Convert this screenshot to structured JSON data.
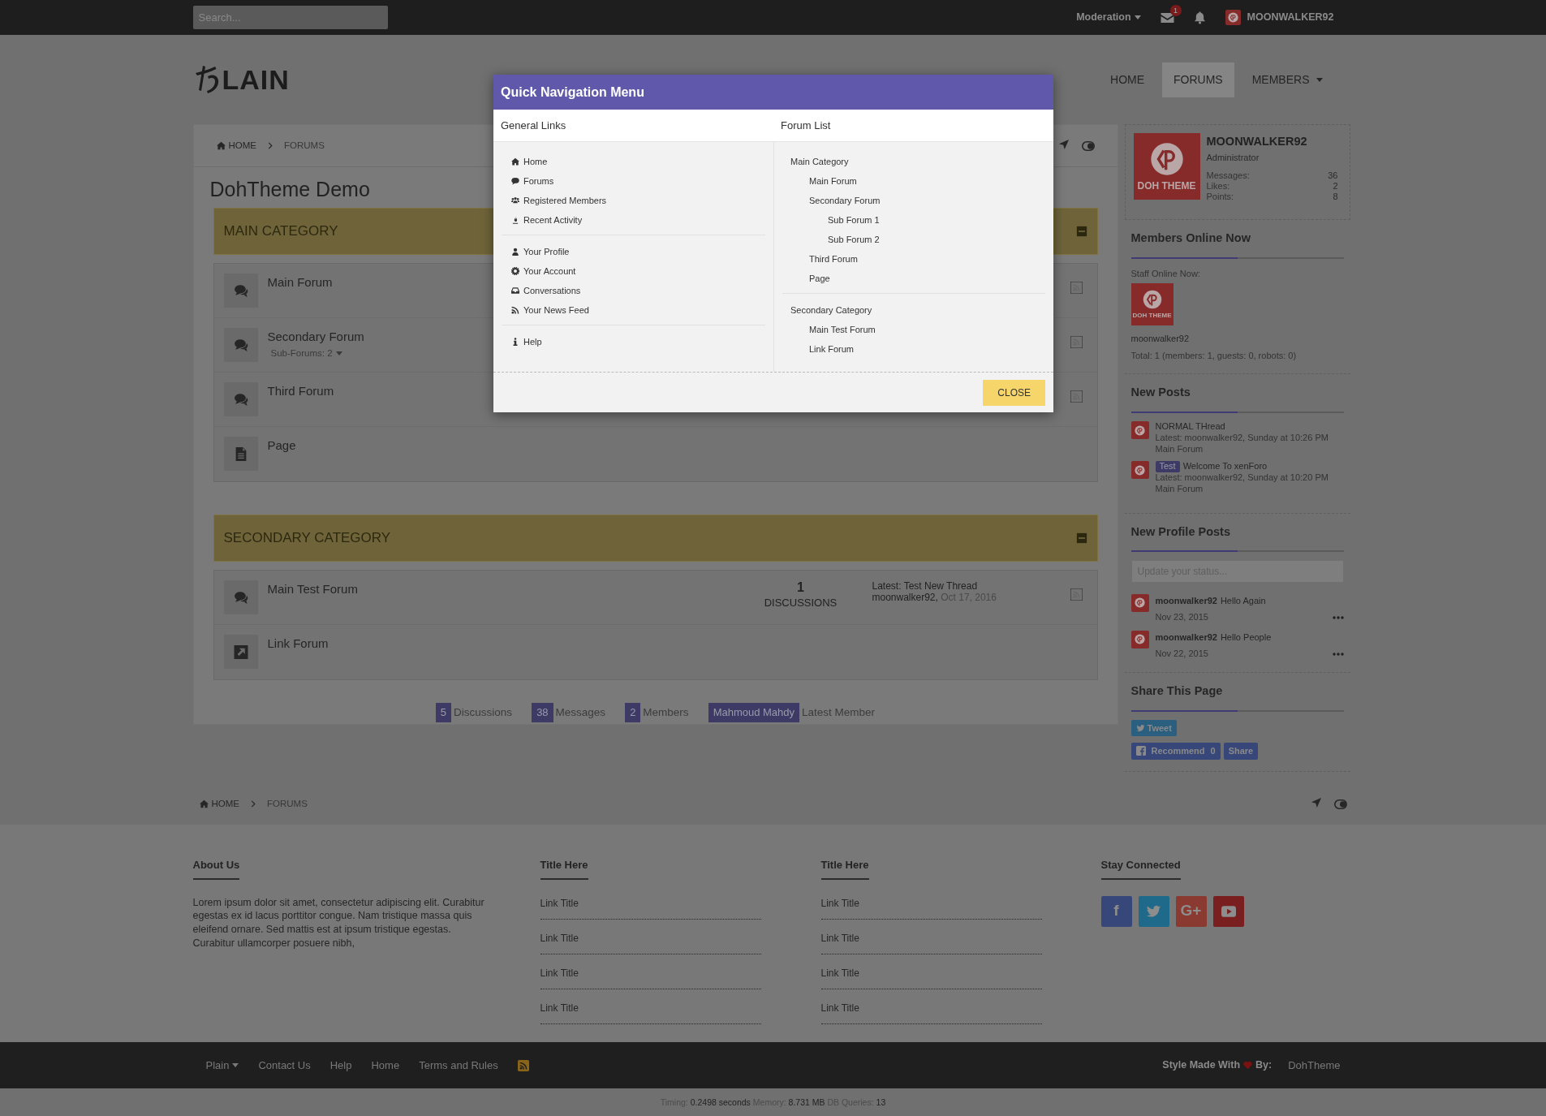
{
  "top_bar": {
    "search": {
      "placeholder": "Search..."
    },
    "moderation": "Moderation",
    "inbox_badge": "1",
    "username": "MOONWALKER92"
  },
  "header": {
    "logo": "LAIN",
    "nav": [
      {
        "label": "HOME",
        "selected": false,
        "dropdown": false
      },
      {
        "label": "FORUMS",
        "selected": true,
        "dropdown": false
      },
      {
        "label": "MEMBERS",
        "selected": false,
        "dropdown": true
      }
    ]
  },
  "breadcrumb": [
    "HOME",
    "FORUMS"
  ],
  "page_title": "DohTheme Demo",
  "categories": [
    {
      "title": "MAIN CATEGORY",
      "forums": [
        {
          "kind": "forum",
          "name": "Main Forum"
        },
        {
          "kind": "forum",
          "name": "Secondary Forum",
          "subforums": "Sub-Forums: 2"
        },
        {
          "kind": "forum",
          "name": "Third Forum"
        },
        {
          "kind": "page",
          "name": "Page"
        }
      ]
    },
    {
      "title": "SECONDARY CATEGORY",
      "forums": [
        {
          "kind": "forum",
          "name": "Main Test Forum",
          "count": "1",
          "count_label": "DISCUSSIONS",
          "latest": "Latest: Test New Thread",
          "latest_user": "moonwalker92,",
          "latest_date": "Oct 17, 2016"
        },
        {
          "kind": "link",
          "name": "Link Forum"
        }
      ]
    }
  ],
  "stats": [
    {
      "count": "5",
      "label": "Discussions"
    },
    {
      "count": "38",
      "label": "Messages"
    },
    {
      "count": "2",
      "label": "Members"
    },
    {
      "count": "Mahmoud Mahdy",
      "label": "Latest Member"
    }
  ],
  "sidebar": {
    "profile": {
      "avatar_caption": "DOH THEME",
      "name": "MOONWALKER92",
      "role": "Administrator",
      "stats": [
        {
          "label": "Messages:",
          "value": "36"
        },
        {
          "label": "Likes:",
          "value": "2"
        },
        {
          "label": "Points:",
          "value": "8"
        }
      ]
    },
    "members_online": {
      "title": "Members Online Now",
      "staff_label": "Staff Online Now:",
      "avatar_caption": "DOH THEME",
      "members": "moonwalker92",
      "total": "Total: 1 (members: 1, guests: 0, robots: 0)"
    },
    "new_posts": {
      "title": "New Posts",
      "posts": [
        {
          "title": "NORMAL THread",
          "meta": "Latest: moonwalker92, Sunday at 10:26 PM",
          "forum": "Main Forum"
        },
        {
          "prefix": "Test",
          "title": "Welcome To xenForo",
          "meta": "Latest: moonwalker92, Sunday at 10:20 PM",
          "forum": "Main Forum"
        }
      ]
    },
    "new_profile_posts": {
      "title": "New Profile Posts",
      "placeholder": "Update your status...",
      "posts": [
        {
          "author": "moonwalker92",
          "text": "Hello Again",
          "date": "Nov 23, 2015"
        },
        {
          "author": "moonwalker92",
          "text": "Hello People",
          "date": "Nov 22, 2015"
        }
      ]
    },
    "share": {
      "title": "Share This Page",
      "tweet": "Tweet",
      "recommend": "Recommend",
      "recommend_count": "0",
      "share": "Share"
    }
  },
  "footer_breadcrumb": [
    "HOME",
    "FORUMS"
  ],
  "footer": {
    "about": {
      "title": "About Us",
      "text": "Lorem ipsum dolor sit amet, consectetur adipiscing elit. Curabitur egestas ex id lacus porttitor congue. Nam tristique massa quis eleifend ornare. Sed mattis est at ipsum tristique egestas. Curabitur ullamcorper posuere nibh,"
    },
    "link_columns": [
      {
        "title": "Title Here",
        "links": [
          "Link Title",
          "Link Title",
          "Link Title",
          "Link Title"
        ]
      },
      {
        "title": "Title Here",
        "links": [
          "Link Title",
          "Link Title",
          "Link Title",
          "Link Title"
        ]
      }
    ],
    "social": {
      "title": "Stay Connected",
      "items": [
        {
          "kind": "facebook",
          "glyph": "f"
        },
        {
          "kind": "twitter"
        },
        {
          "kind": "google",
          "glyph": "G+"
        },
        {
          "kind": "youtube"
        }
      ]
    }
  },
  "bottom_bar": {
    "links": [
      {
        "label": "Plain",
        "dropdown": true
      },
      {
        "label": "Contact Us",
        "dropdown": false
      },
      {
        "label": "Help",
        "dropdown": false
      },
      {
        "label": "Home",
        "dropdown": false
      },
      {
        "label": "Terms and Rules",
        "dropdown": false
      }
    ],
    "credit": "Style Made With",
    "credit_by": "By:",
    "credit_link": "DohTheme"
  },
  "timing": [
    {
      "label": "Timing:",
      "value": "0.2498 seconds"
    },
    {
      "label": "Memory:",
      "value": "8.731 MB"
    },
    {
      "label": "DB Queries:",
      "value": "13"
    }
  ],
  "modal": {
    "title": "Quick Navigation Menu",
    "general_title": "General Links",
    "forum_title": "Forum List",
    "general_groups": [
      [
        "Home",
        "Forums",
        "Registered Members",
        "Recent Activity"
      ],
      [
        "Your Profile",
        "Your Account",
        "Conversations",
        "Your News Feed"
      ],
      [
        "Help"
      ]
    ],
    "forum_groups": [
      {
        "label": "Main Category",
        "children": [
          {
            "label": "Main Forum"
          },
          {
            "label": "Secondary Forum",
            "children": [
              {
                "label": "Sub Forum 1"
              },
              {
                "label": "Sub Forum 2"
              }
            ]
          },
          {
            "label": "Third Forum"
          },
          {
            "label": "Page"
          }
        ]
      },
      {
        "label": "Secondary Category",
        "children": [
          {
            "label": "Main Test Forum"
          },
          {
            "label": "Link Forum"
          }
        ]
      }
    ],
    "close": "CLOSE"
  }
}
